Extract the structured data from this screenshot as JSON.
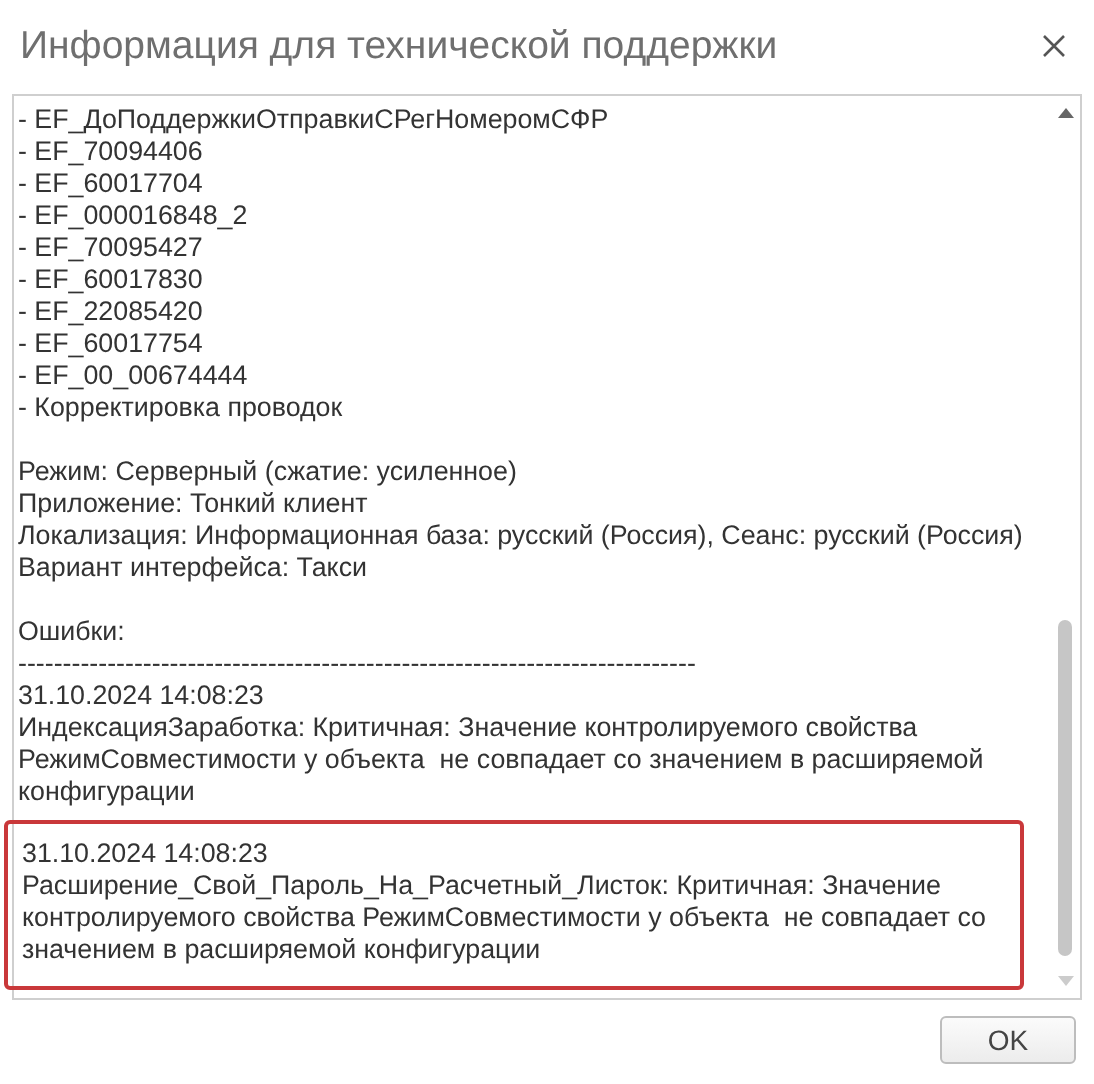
{
  "window": {
    "title": "Информация для технической поддержки"
  },
  "modules": [
    "- EF_ДоПоддержкиОтправкиСРегНомеромСФР",
    "- EF_70094406",
    "- EF_60017704",
    "- EF_000016848_2",
    "- EF_70095427",
    "- EF_60017830",
    "- EF_22085420",
    "- EF_60017754",
    "- EF_00_00674444",
    "- Корректировка проводок"
  ],
  "environment": [
    "Режим: Серверный (сжатие: усиленное)",
    "Приложение: Тонкий клиент",
    "Локализация: Информационная база: русский (Россия), Сеанс: русский (Россия)",
    "Вариант интерфейса: Такси"
  ],
  "errors_heading": "Ошибки:",
  "separator": "----------------------------------------------------------------------------",
  "errors": [
    {
      "timestamp": "31.10.2024 14:08:23",
      "lines": [
        "ИндексацияЗаработка: Критичная: Значение контролируемого свойства",
        "РежимСовместимости у объекта  не совпадает со значением в расширяемой",
        "конфигурации"
      ],
      "highlighted": false
    },
    {
      "timestamp": "31.10.2024 14:08:23",
      "lines": [
        "Расширение_Свой_Пароль_На_Расчетный_Листок: Критичная: Значение",
        "контролируемого свойства РежимСовместимости у объекта  не совпадает со",
        "значением в расширяемой конфигурации"
      ],
      "highlighted": true
    }
  ],
  "buttons": [
    "OK"
  ]
}
